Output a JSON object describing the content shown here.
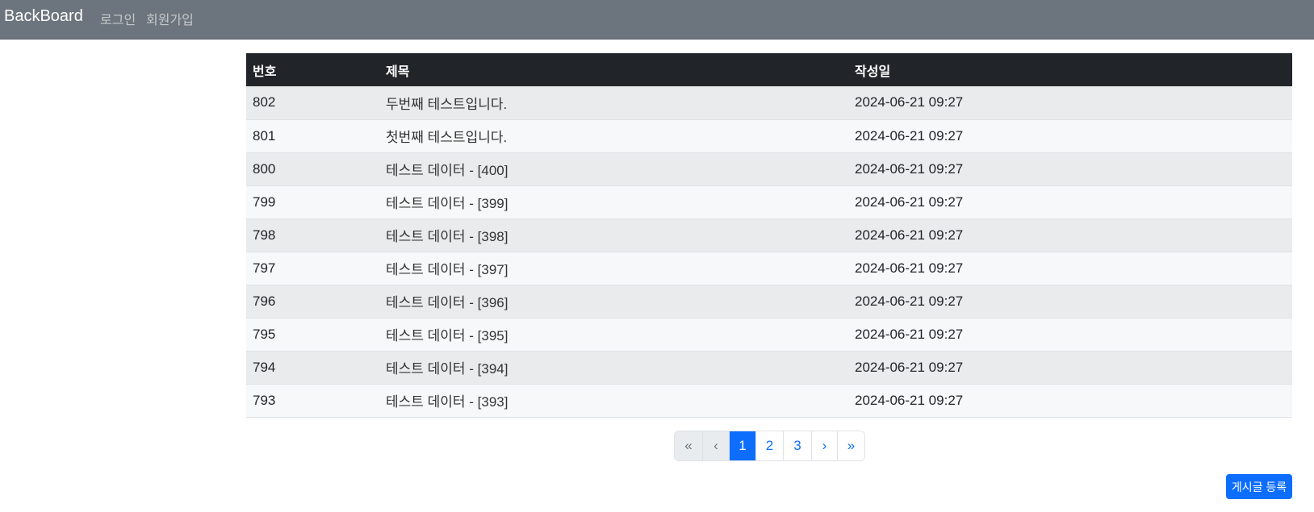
{
  "navbar": {
    "brand": "BackBoard",
    "links": [
      {
        "label": "로그인"
      },
      {
        "label": "회원가입"
      }
    ]
  },
  "table": {
    "columns": [
      "번호",
      "제목",
      "작성일"
    ],
    "rows": [
      {
        "num": "802",
        "title": "두번째 테스트입니다.",
        "date": "2024-06-21 09:27"
      },
      {
        "num": "801",
        "title": "첫번째 테스트입니다.",
        "date": "2024-06-21 09:27"
      },
      {
        "num": "800",
        "title": "테스트 데이터 - [400]",
        "date": "2024-06-21 09:27"
      },
      {
        "num": "799",
        "title": "테스트 데이터 - [399]",
        "date": "2024-06-21 09:27"
      },
      {
        "num": "798",
        "title": "테스트 데이터 - [398]",
        "date": "2024-06-21 09:27"
      },
      {
        "num": "797",
        "title": "테스트 데이터 - [397]",
        "date": "2024-06-21 09:27"
      },
      {
        "num": "796",
        "title": "테스트 데이터 - [396]",
        "date": "2024-06-21 09:27"
      },
      {
        "num": "795",
        "title": "테스트 데이터 - [395]",
        "date": "2024-06-21 09:27"
      },
      {
        "num": "794",
        "title": "테스트 데이터 - [394]",
        "date": "2024-06-21 09:27"
      },
      {
        "num": "793",
        "title": "테스트 데이터 - [393]",
        "date": "2024-06-21 09:27"
      }
    ]
  },
  "pagination": {
    "first": "«",
    "prev": "‹",
    "pages": [
      "1",
      "2",
      "3"
    ],
    "current": "1",
    "next": "›",
    "last": "»"
  },
  "actions": {
    "register_label": "게시글 등록"
  },
  "colors": {
    "navbar_bg": "#6c757d",
    "table_header_bg": "#212529",
    "primary": "#0d6efd"
  }
}
